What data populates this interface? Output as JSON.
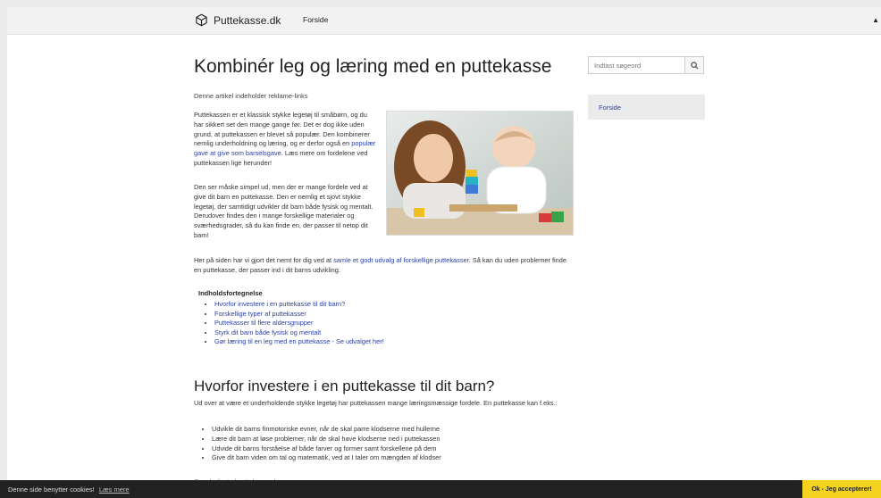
{
  "header": {
    "brand": "Puttekasse.dk",
    "nav_home": "Forside"
  },
  "article": {
    "title": "Kombinér leg og læring med en puttekasse",
    "disclaimer": "Denne artikel indeholder reklame-links",
    "intro1_a": "Puttekassen er et klassisk stykke legetøj til småbørn, og du har sikkert set den mange gange før. Det er dog ikke uden grund, at puttekassen er blevet så populær. Den kombinerer nemlig underholdning og læring, og er derfor også en ",
    "intro1_link": "populær gave at give som barselsgave",
    "intro1_b": ". Læs mere om fordelene ved puttekassen lige herunder!",
    "intro2": "Den ser måske simpel ud, men der er mange fordele ved at give dit barn en puttekasse. Den er nemlig et sjovt stykke legetøj, der samtidigt udvikler dit barn både fysisk og mentalt. Derudover findes den i mange forskellige materialer og sværhedsgrader, så du kan finde en, der passer til netop dit barn!",
    "intro3_a": "Her på siden har vi gjort det nemt for dig ved at ",
    "intro3_link": "samle et godt udvalg af forskellige puttekasser",
    "intro3_b": ". Så kan du uden problemer finde en puttekasse, der passer ind i dit barns udvikling.",
    "toc_title": "Indholdsfortegnelse",
    "toc_items": [
      "Hvorfor investere i en puttekasse til dit barn?",
      "Forskellige typer af puttekasser",
      "Puttekasser til flere aldersgrupper",
      "Styrk dit barn både fysisk og mentalt",
      "Gør læring til en leg med en puttekasse - Se udvalget her!"
    ],
    "h2": "Hvorfor investere i en puttekasse til dit barn?",
    "why_text": "Ud over at være et underholdende stykke legetøj har puttekassen mange læringsmæssige fordele. En puttekasse kan f.eks.:",
    "benefits": [
      "Udvikle dit barns finmotoriske evner, når de skal parre klodserne med hullerne",
      "Lære dit barn at løse problemer, når de skal have klodserne ned i puttekassen",
      "Udvide dit barns forståelse af både farver og former samt forskellene på dem",
      "Give dit barn viden om tal og matematik, ved at I taler om mængden af klodser"
    ],
    "faded_link": "Se udvalget af puttekasser her"
  },
  "sidebar": {
    "search_placeholder": "Indtast søgeord",
    "nav_item": "Forside"
  },
  "cookie": {
    "text": "Denne side benytter cookies!",
    "more": "Læs mere",
    "accept": "Ok - Jeg accepterer!"
  }
}
